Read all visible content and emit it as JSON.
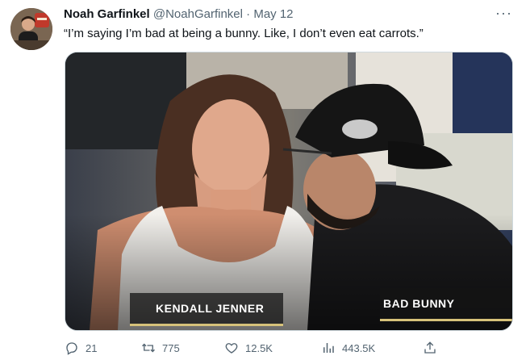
{
  "tweet": {
    "display_name": "Noah Garfinkel",
    "handle": "@NoahGarfinkel",
    "separator": "·",
    "date": "May 12",
    "more": "···",
    "text": "“I’m saying I’m bad at being a bunny. Like, I don’t even eat carrots.”"
  },
  "media": {
    "caption_left": "KENDALL JENNER",
    "caption_right": "BAD BUNNY"
  },
  "actions": {
    "replies": "21",
    "retweets": "775",
    "likes": "12.5K",
    "views": "443.5K"
  },
  "icons": [
    "reply-icon",
    "retweet-icon",
    "like-icon",
    "views-icon",
    "share-icon",
    "more-icon"
  ],
  "colors": {
    "muted": "#536471",
    "text": "#0f1419",
    "border": "#cfd9de"
  }
}
